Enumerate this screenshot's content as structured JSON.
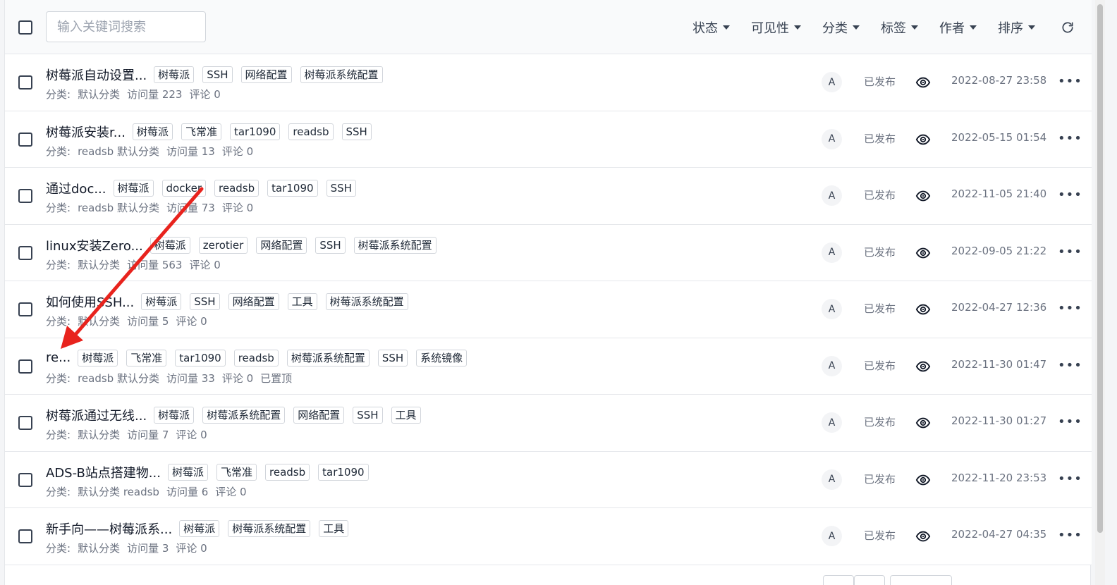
{
  "toolbar": {
    "search_placeholder": "输入关键词搜索",
    "filters": [
      "状态",
      "可见性",
      "分类",
      "标签",
      "作者",
      "排序"
    ]
  },
  "posts": [
    {
      "title": "树莓派自动设置...",
      "tags": [
        "树莓派",
        "SSH",
        "网络配置",
        "树莓派系统配置"
      ],
      "meta": [
        "分类:",
        "默认分类",
        "访问量 223",
        "评论 0"
      ],
      "author": "A",
      "status": "已发布",
      "date": "2022-08-27 23:58"
    },
    {
      "title": "树莓派安装r...",
      "tags": [
        "树莓派",
        "飞常准",
        "tar1090",
        "readsb",
        "SSH"
      ],
      "meta": [
        "分类:",
        "readsb 默认分类",
        "访问量 13",
        "评论 0"
      ],
      "author": "A",
      "status": "已发布",
      "date": "2022-05-15 01:54"
    },
    {
      "title": "通过doc...",
      "tags": [
        "树莓派",
        "docker",
        "readsb",
        "tar1090",
        "SSH"
      ],
      "meta": [
        "分类:",
        "readsb 默认分类",
        "访问量 73",
        "评论 0"
      ],
      "author": "A",
      "status": "已发布",
      "date": "2022-11-05 21:40"
    },
    {
      "title": "linux安装Zero...",
      "tags": [
        "树莓派",
        "zerotier",
        "网络配置",
        "SSH",
        "树莓派系统配置"
      ],
      "meta": [
        "分类:",
        "默认分类",
        "访问量 563",
        "评论 0"
      ],
      "author": "A",
      "status": "已发布",
      "date": "2022-09-05 21:22"
    },
    {
      "title": "如何使用SSH...",
      "tags": [
        "树莓派",
        "SSH",
        "网络配置",
        "工具",
        "树莓派系统配置"
      ],
      "meta": [
        "分类:",
        "默认分类",
        "访问量 5",
        "评论 0"
      ],
      "author": "A",
      "status": "已发布",
      "date": "2022-04-27 12:36"
    },
    {
      "title": "re...",
      "tags": [
        "树莓派",
        "飞常准",
        "tar1090",
        "readsb",
        "树莓派系统配置",
        "SSH",
        "系统镜像"
      ],
      "meta": [
        "分类:",
        "readsb 默认分类",
        "访问量 33",
        "评论 0",
        "已置顶"
      ],
      "author": "A",
      "status": "已发布",
      "date": "2022-11-30 01:47"
    },
    {
      "title": "树莓派通过无线...",
      "tags": [
        "树莓派",
        "树莓派系统配置",
        "网络配置",
        "SSH",
        "工具"
      ],
      "meta": [
        "分类:",
        "默认分类",
        "访问量 7",
        "评论 0"
      ],
      "author": "A",
      "status": "已发布",
      "date": "2022-11-30 01:27"
    },
    {
      "title": "ADS-B站点搭建物...",
      "tags": [
        "树莓派",
        "飞常准",
        "readsb",
        "tar1090"
      ],
      "meta": [
        "分类:",
        "默认分类 readsb",
        "访问量 6",
        "评论 0"
      ],
      "author": "A",
      "status": "已发布",
      "date": "2022-11-20 23:53"
    },
    {
      "title": "新手向——树莓派系...",
      "tags": [
        "树莓派",
        "树莓派系统配置",
        "工具"
      ],
      "meta": [
        "分类:",
        "默认分类",
        "访问量 3",
        "评论 0"
      ],
      "author": "A",
      "status": "已发布",
      "date": "2022-04-27 04:35"
    }
  ],
  "colors": {
    "annotation_arrow": "#e8231d",
    "border": "#e5e7eb",
    "muted_text": "#6b7280"
  }
}
